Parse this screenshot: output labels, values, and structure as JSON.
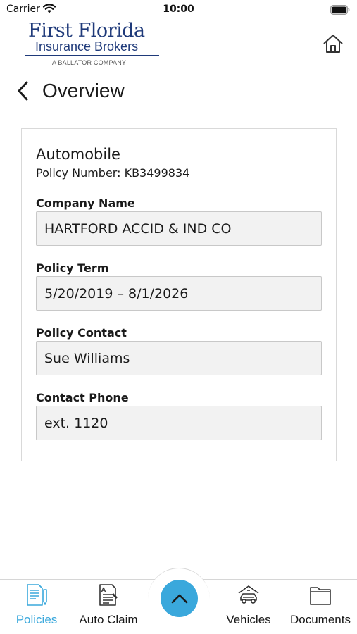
{
  "status_bar": {
    "carrier": "Carrier",
    "time": "10:00"
  },
  "header": {
    "logo": {
      "line1": "First Florida",
      "line2": "Insurance Brokers",
      "line3": "A BALLATOR COMPANY"
    },
    "home_icon": "home-icon"
  },
  "page": {
    "back_icon": "chevron-left-icon",
    "title": "Overview"
  },
  "policy": {
    "type": "Automobile",
    "number_text": "Policy Number: KB3499834",
    "fields": [
      {
        "label": "Company Name",
        "value": "HARTFORD ACCID & IND CO"
      },
      {
        "label": "Policy Term",
        "value": "5/20/2019 – 8/1/2026"
      },
      {
        "label": "Policy Contact",
        "value": "Sue Williams"
      },
      {
        "label": "Contact Phone",
        "value": "ext. 1120"
      }
    ]
  },
  "tab_bar": {
    "tabs": [
      {
        "label": "Policies",
        "icon": "policy-document-icon",
        "active": true
      },
      {
        "label": "Auto Claim",
        "icon": "claim-form-icon",
        "active": false
      },
      {
        "label": "Vehicles",
        "icon": "car-garage-icon",
        "active": false
      },
      {
        "label": "Documents",
        "icon": "folder-icon",
        "active": false
      }
    ],
    "center_button_icon": "chevron-up-icon"
  },
  "colors": {
    "brand_navy": "#1f3a7a",
    "accent_blue": "#3aa8dc",
    "field_bg": "#f2f2f2"
  }
}
